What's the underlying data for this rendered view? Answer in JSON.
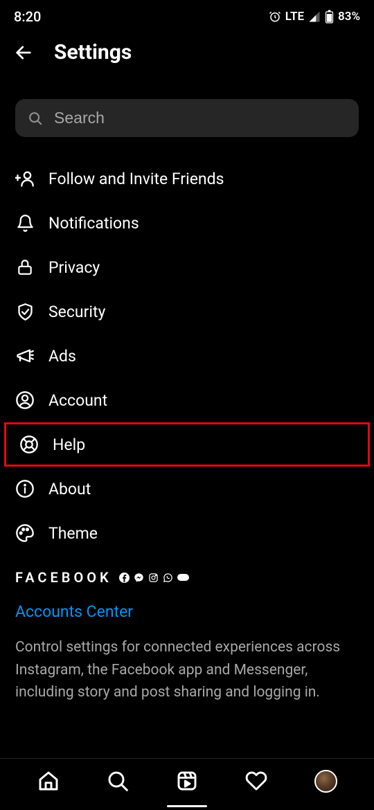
{
  "status": {
    "time": "8:20",
    "lte": "LTE",
    "battery": "83%"
  },
  "header": {
    "title": "Settings"
  },
  "search": {
    "placeholder": "Search"
  },
  "menu": {
    "items": [
      {
        "label": "Follow and Invite Friends",
        "icon": "add-user-icon"
      },
      {
        "label": "Notifications",
        "icon": "bell-icon"
      },
      {
        "label": "Privacy",
        "icon": "lock-icon"
      },
      {
        "label": "Security",
        "icon": "shield-icon"
      },
      {
        "label": "Ads",
        "icon": "megaphone-icon"
      },
      {
        "label": "Account",
        "icon": "user-circle-icon"
      },
      {
        "label": "Help",
        "icon": "lifebuoy-icon",
        "highlighted": true
      },
      {
        "label": "About",
        "icon": "info-icon"
      },
      {
        "label": "Theme",
        "icon": "palette-icon"
      }
    ]
  },
  "facebook": {
    "brand": "FACEBOOK",
    "accounts_link": "Accounts Center",
    "description": "Control settings for connected experiences across Instagram, the Facebook app and Messenger, including story and post sharing and logging in."
  }
}
